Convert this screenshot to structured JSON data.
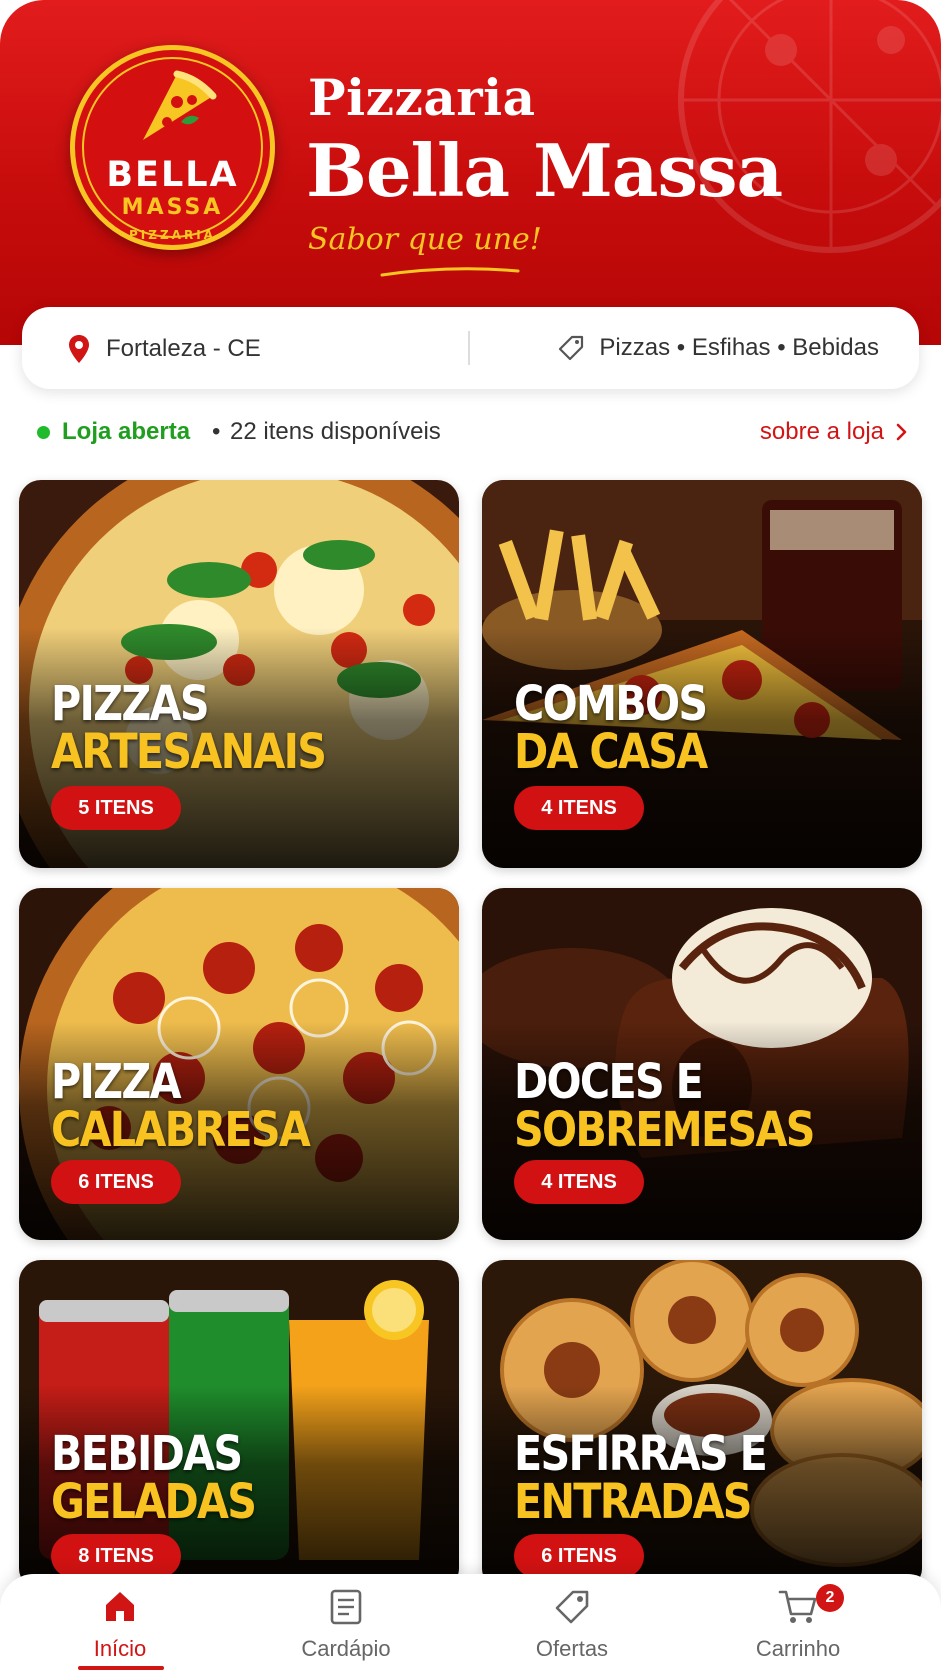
{
  "brand": {
    "logo_top": "BELLA",
    "logo_mid": "MASSA",
    "logo_bottom": "PIZZARIA",
    "title_small": "Pizzaria",
    "title_big": "Bella Massa",
    "tagline": "Sabor que une!"
  },
  "info": {
    "location": "Fortaleza - CE",
    "categories": "Pizzas • Esfihas • Bebidas"
  },
  "status": {
    "open_label": "Loja aberta",
    "separator": "•",
    "items_available": "22 itens disponíveis",
    "about_link": "sobre a loja"
  },
  "categories": [
    {
      "line1": "PIZZAS",
      "line2": "ARTESANAIS",
      "badge": "5 ITENS",
      "icon": "margherita-pizza"
    },
    {
      "line1": "COMBOS",
      "line2": "DA CASA",
      "badge": "4 ITENS",
      "icon": "combo-fries-soda"
    },
    {
      "line1": "PIZZA",
      "line2": "CALABRESA",
      "badge": "6 ITENS",
      "icon": "calabresa-pizza"
    },
    {
      "line1": "DOCES E",
      "line2": "SOBREMESAS",
      "badge": "4 ITENS",
      "icon": "chocolate-dessert"
    },
    {
      "line1": "BEBIDAS",
      "line2": "GELADAS",
      "badge": "8 ITENS",
      "icon": "cold-drinks"
    },
    {
      "line1": "ESFIRRAS E",
      "line2": "ENTRADAS",
      "badge": "6 ITENS",
      "icon": "esfirras"
    }
  ],
  "nav": {
    "items": [
      {
        "label": "Início",
        "icon": "home-icon",
        "active": true
      },
      {
        "label": "Cardápio",
        "icon": "menu-book-icon",
        "active": false
      },
      {
        "label": "Ofertas",
        "icon": "tag-icon",
        "active": false
      },
      {
        "label": "Carrinho",
        "icon": "cart-icon",
        "active": false
      }
    ],
    "cart_count": "2"
  },
  "colors": {
    "brand_red": "#d11414",
    "accent_yellow": "#f7c623",
    "open_green": "#1fbb2c"
  }
}
